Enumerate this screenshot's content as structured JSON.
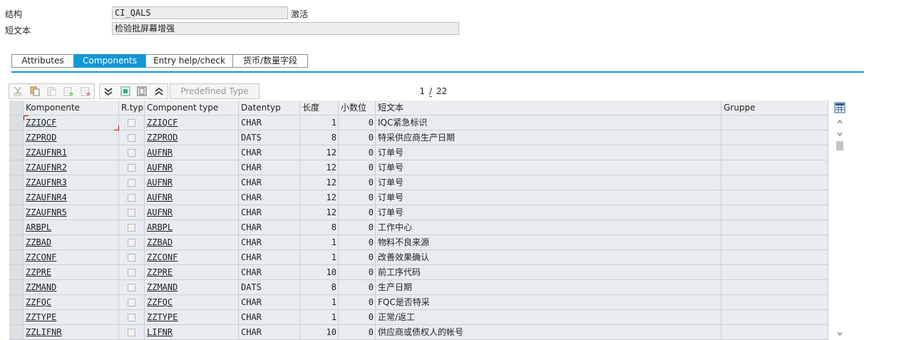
{
  "header": {
    "structure_label": "结构",
    "structure_value": "CI_QALS",
    "status": "激活",
    "short_text_label": "短文本",
    "short_text_value": "检验批屏幕增强"
  },
  "tabs": [
    {
      "label": "Attributes",
      "active": false
    },
    {
      "label": "Components",
      "active": true
    },
    {
      "label": "Entry help/check",
      "active": false
    },
    {
      "label": "货币/数量字段",
      "active": false
    }
  ],
  "toolbar": {
    "icons": [
      "cut-icon",
      "copy-icon",
      "paste-icon",
      "insert-row-icon",
      "delete-row-icon",
      "collapse-icon",
      "new-node-icon",
      "detail-icon",
      "expand-icon"
    ],
    "predefined_type_label": "Predefined Type"
  },
  "pager": {
    "current": "1",
    "separator": "/",
    "total": "22"
  },
  "table": {
    "columns": [
      "Komponente",
      "R.typ",
      "Component type",
      "Datentyp",
      "长度",
      "小数位",
      "短文本",
      "Gruppe"
    ],
    "rows": [
      {
        "komponente": "ZZIQCF",
        "comp_type": "ZZIQCF",
        "datentyp": "CHAR",
        "laenge": "1",
        "dez": "0",
        "text": "IQC紧急标识"
      },
      {
        "komponente": "ZZPROD",
        "comp_type": "ZZPROD",
        "datentyp": "DATS",
        "laenge": "8",
        "dez": "0",
        "text": "特采供应商生产日期"
      },
      {
        "komponente": "ZZAUFNR1",
        "comp_type": "AUFNR",
        "datentyp": "CHAR",
        "laenge": "12",
        "dez": "0",
        "text": "订单号"
      },
      {
        "komponente": "ZZAUFNR2",
        "comp_type": "AUFNR",
        "datentyp": "CHAR",
        "laenge": "12",
        "dez": "0",
        "text": "订单号"
      },
      {
        "komponente": "ZZAUFNR3",
        "comp_type": "AUFNR",
        "datentyp": "CHAR",
        "laenge": "12",
        "dez": "0",
        "text": "订单号"
      },
      {
        "komponente": "ZZAUFNR4",
        "comp_type": "AUFNR",
        "datentyp": "CHAR",
        "laenge": "12",
        "dez": "0",
        "text": "订单号"
      },
      {
        "komponente": "ZZAUFNR5",
        "comp_type": "AUFNR",
        "datentyp": "CHAR",
        "laenge": "12",
        "dez": "0",
        "text": "订单号"
      },
      {
        "komponente": "ARBPL",
        "comp_type": "ARBPL",
        "datentyp": "CHAR",
        "laenge": "8",
        "dez": "0",
        "text": "工作中心"
      },
      {
        "komponente": "ZZBAD",
        "comp_type": "ZZBAD",
        "datentyp": "CHAR",
        "laenge": "1",
        "dez": "0",
        "text": "物料不良来源"
      },
      {
        "komponente": "ZZCONF",
        "comp_type": "ZZCONF",
        "datentyp": "CHAR",
        "laenge": "1",
        "dez": "0",
        "text": "改善效果确认"
      },
      {
        "komponente": "ZZPRE",
        "comp_type": "ZZPRE",
        "datentyp": "CHAR",
        "laenge": "10",
        "dez": "0",
        "text": "前工序代码"
      },
      {
        "komponente": "ZZMAND",
        "comp_type": "ZZMAND",
        "datentyp": "DATS",
        "laenge": "8",
        "dez": "0",
        "text": "生产日期"
      },
      {
        "komponente": "ZZFQC",
        "comp_type": "ZZFQC",
        "datentyp": "CHAR",
        "laenge": "1",
        "dez": "0",
        "text": "FQC是否特采"
      },
      {
        "komponente": "ZZTYPE",
        "comp_type": "ZZTYPE",
        "datentyp": "CHAR",
        "laenge": "1",
        "dez": "0",
        "text": "正常/返工"
      },
      {
        "komponente": "ZZLIFNR",
        "comp_type": "LIFNR",
        "datentyp": "CHAR",
        "laenge": "10",
        "dez": "0",
        "text": "供应商或债权人的帐号"
      }
    ]
  },
  "colors": {
    "accent": "#1196d6",
    "grid_bg": "#e8ecf0",
    "header_bg": "#ebedf0"
  }
}
